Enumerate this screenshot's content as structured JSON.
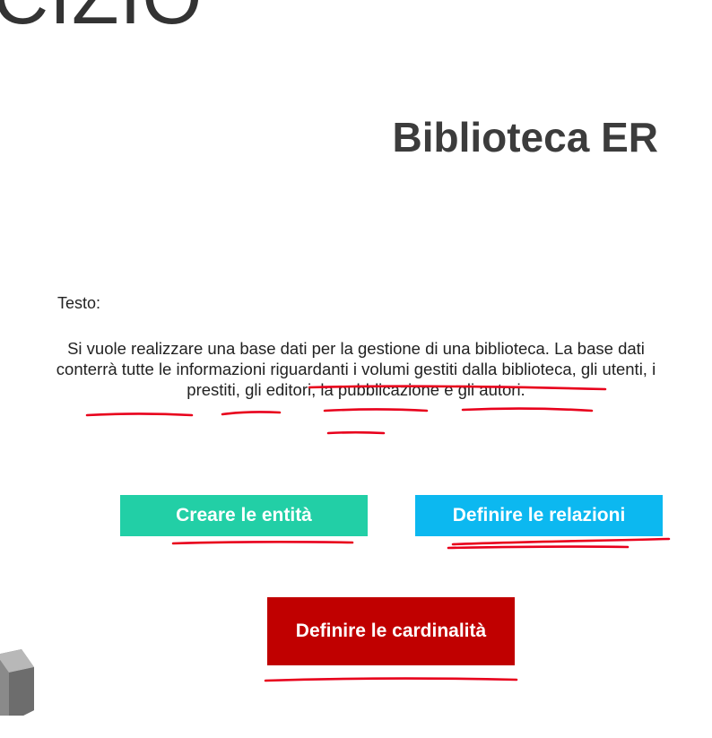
{
  "header": {
    "cut_title": "CIZIO",
    "title": "Biblioteca ER"
  },
  "content": {
    "label": "Testo:",
    "paragraph_segments": [
      "Si vuole realizzare una base dati per la gestione di una biblioteca. La base dati conterrà tutte le informazioni riguardanti i volumi gestiti dalla biblioteca, gli utenti, i prestiti, gli editori, la pubblicazione e gli autori."
    ]
  },
  "buttons": {
    "entita": "Creare le entità",
    "relazioni": "Definire le relazioni",
    "cardinalita": "Definire le cardinalità"
  },
  "colors": {
    "entita_bg": "#22cfa6",
    "relazioni_bg": "#0cb8f0",
    "cardinalita_bg": "#c00000",
    "annotation_ink": "#e8001c"
  }
}
